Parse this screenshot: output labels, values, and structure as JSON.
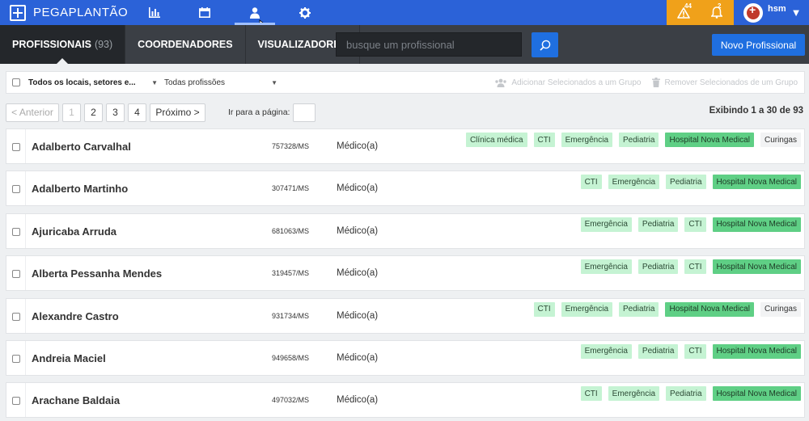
{
  "app": {
    "logo_text": "PEGAPLANTÃO"
  },
  "nav": [
    {
      "icon": "bar-chart-icon"
    },
    {
      "icon": "calendar-icon"
    },
    {
      "icon": "person-icon",
      "active": true
    },
    {
      "icon": "gear-icon"
    }
  ],
  "alerts": [
    {
      "icon": "warning-icon",
      "badge": "44"
    },
    {
      "icon": "alarm-icon",
      "badge": "2"
    }
  ],
  "user": {
    "name": "hsm",
    "caret": "▼"
  },
  "subtabs": [
    {
      "label": "PROFISSIONAIS",
      "count": "(93)",
      "active": true
    },
    {
      "label": "COORDENADORES",
      "count": ""
    },
    {
      "label": "VISUALIZADORES",
      "count": ""
    }
  ],
  "search": {
    "placeholder": "busque um profissional"
  },
  "new_button": "Novo Profissional",
  "filters": {
    "locations": "Todos os locais, setores e...",
    "professions": "Todas profissões",
    "add_group": "Adicionar Selecionados a um Grupo",
    "remove_group": "Remover Selecionados de um Grupo",
    "caret": "▼"
  },
  "pagination": {
    "prev": "< Anterior",
    "pages": [
      "1",
      "2",
      "3",
      "4"
    ],
    "next": "Próximo >",
    "goto_label": "Ir para a página:",
    "showing": "Exibindo 1 a 30 de 93"
  },
  "colors": {
    "brand": "#2b62d8",
    "alert": "#f0a11a",
    "primary_button": "#1f6fe0",
    "tag_light": "#c5f3d3",
    "tag_hospital": "#5fcf85"
  },
  "professionals": [
    {
      "name": "Adalberto Carvalhal",
      "crm": "757328/MS",
      "role": "Médico(a)",
      "tags": [
        {
          "t": "Clínica médica",
          "k": "light"
        },
        {
          "t": "CTI",
          "k": "light"
        },
        {
          "t": "Emergência",
          "k": "light"
        },
        {
          "t": "Pediatria",
          "k": "light"
        },
        {
          "t": "Hospital Nova Medical",
          "k": "hosp"
        },
        {
          "t": "Curingas",
          "k": "gray"
        }
      ]
    },
    {
      "name": "Adalberto Martinho",
      "crm": "307471/MS",
      "role": "Médico(a)",
      "tags": [
        {
          "t": "CTI",
          "k": "light"
        },
        {
          "t": "Emergência",
          "k": "light"
        },
        {
          "t": "Pediatria",
          "k": "light"
        },
        {
          "t": "Hospital Nova Medical",
          "k": "hosp"
        }
      ]
    },
    {
      "name": "Ajuricaba Arruda",
      "crm": "681063/MS",
      "role": "Médico(a)",
      "tags": [
        {
          "t": "Emergência",
          "k": "light"
        },
        {
          "t": "Pediatria",
          "k": "light"
        },
        {
          "t": "CTI",
          "k": "light"
        },
        {
          "t": "Hospital Nova Medical",
          "k": "hosp"
        }
      ]
    },
    {
      "name": "Alberta Pessanha Mendes",
      "crm": "319457/MS",
      "role": "Médico(a)",
      "tags": [
        {
          "t": "Emergência",
          "k": "light"
        },
        {
          "t": "Pediatria",
          "k": "light"
        },
        {
          "t": "CTI",
          "k": "light"
        },
        {
          "t": "Hospital Nova Medical",
          "k": "hosp"
        }
      ]
    },
    {
      "name": "Alexandre Castro",
      "crm": "931734/MS",
      "role": "Médico(a)",
      "tags": [
        {
          "t": "CTI",
          "k": "light"
        },
        {
          "t": "Emergência",
          "k": "light"
        },
        {
          "t": "Pediatria",
          "k": "light"
        },
        {
          "t": "Hospital Nova Medical",
          "k": "hosp"
        },
        {
          "t": "Curingas",
          "k": "gray"
        }
      ]
    },
    {
      "name": "Andreia Maciel",
      "crm": "949658/MS",
      "role": "Médico(a)",
      "tags": [
        {
          "t": "Emergência",
          "k": "light"
        },
        {
          "t": "Pediatria",
          "k": "light"
        },
        {
          "t": "CTI",
          "k": "light"
        },
        {
          "t": "Hospital Nova Medical",
          "k": "hosp"
        }
      ]
    },
    {
      "name": "Arachane Baldaia",
      "crm": "497032/MS",
      "role": "Médico(a)",
      "tags": [
        {
          "t": "CTI",
          "k": "light"
        },
        {
          "t": "Emergência",
          "k": "light"
        },
        {
          "t": "Pediatria",
          "k": "light"
        },
        {
          "t": "Hospital Nova Medical",
          "k": "hosp"
        }
      ]
    }
  ]
}
